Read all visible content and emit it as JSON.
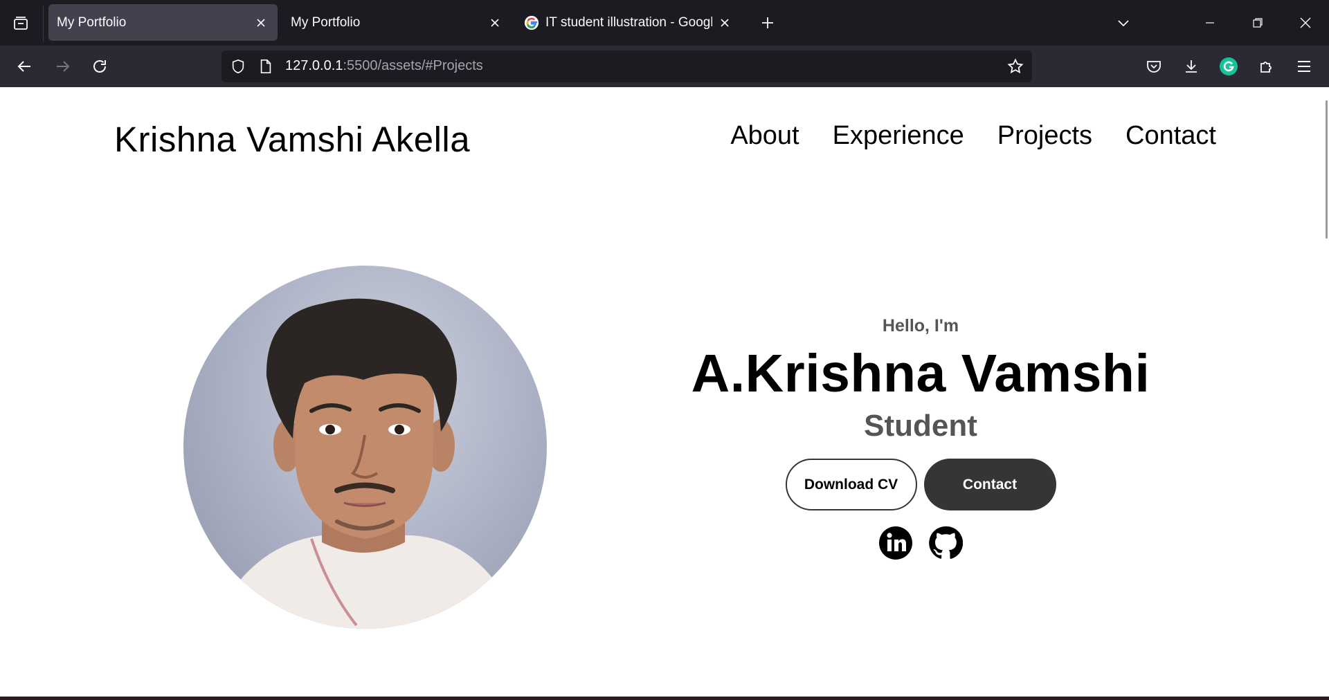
{
  "browser": {
    "tabs": [
      {
        "title": "My Portfolio",
        "active": true
      },
      {
        "title": "My Portfolio",
        "active": false
      },
      {
        "title": "IT student illustration - Google S",
        "active": false
      }
    ],
    "url_host": "127.0.0.1",
    "url_rest": ":5500/assets/#Projects"
  },
  "site": {
    "brand": "Krishna Vamshi Akella",
    "nav": [
      "About",
      "Experience",
      "Projects",
      "Contact"
    ]
  },
  "hero": {
    "greeting": "Hello, I'm",
    "name": "A.Krishna Vamshi",
    "role": "Student",
    "download_cv": "Download CV",
    "contact": "Contact"
  },
  "icons": {
    "social_1": "linkedin-icon",
    "social_2": "github-icon"
  },
  "colors": {
    "chrome_dark": "#1c1b22",
    "chrome_toolbar": "#2b2a33",
    "button_dark": "#353535",
    "grammarly_green": "#15c39a"
  }
}
